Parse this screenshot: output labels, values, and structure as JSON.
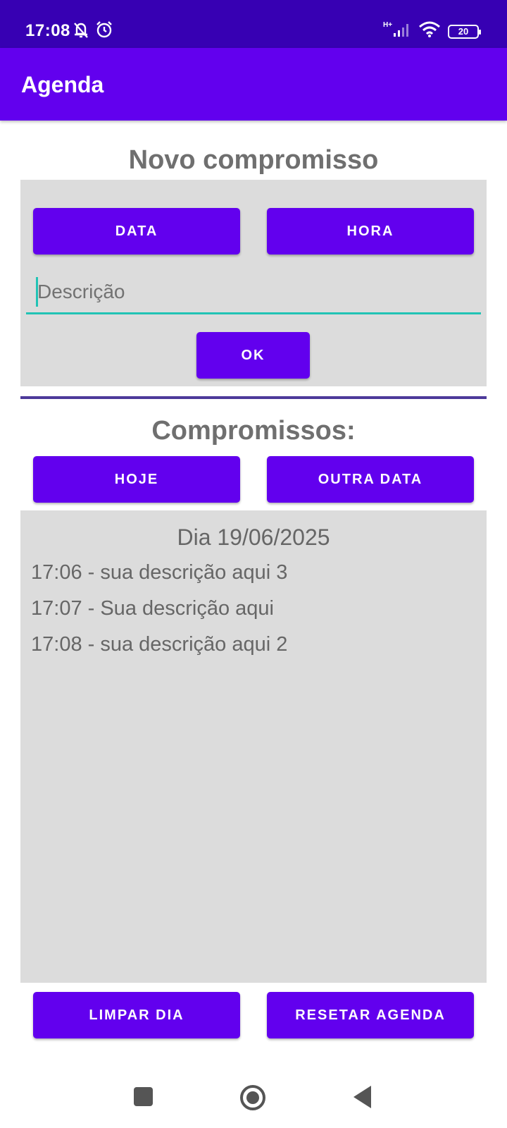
{
  "status": {
    "time": "17:08",
    "network": "H+",
    "battery": "20"
  },
  "app_bar": {
    "title": "Agenda"
  },
  "new_section": {
    "title": "Novo compromisso",
    "date_button": "DATA",
    "time_button": "HORA",
    "description_placeholder": "Descrição",
    "ok_button": "OK"
  },
  "list_section": {
    "title": "Compromissos:",
    "today_button": "HOJE",
    "other_date_button": "OUTRA DATA",
    "day_title": "Dia 19/06/2025",
    "entries": [
      "17:06 - sua descrição aqui 3",
      "17:07 - Sua descrição aqui",
      "17:08 - sua descrição aqui 2"
    ]
  },
  "footer": {
    "clear_day_button": "LIMPAR DIA",
    "reset_button": "RESETAR AGENDA"
  },
  "colors": {
    "status_bar": "#3700b3",
    "primary": "#6200ee",
    "accent": "#21c3b5",
    "panel": "#dcdcdc"
  },
  "icons": [
    "notifications-off-icon",
    "alarm-icon",
    "signal-icon",
    "wifi-icon",
    "battery-icon",
    "nav-recents-icon",
    "nav-home-icon",
    "nav-back-icon"
  ]
}
